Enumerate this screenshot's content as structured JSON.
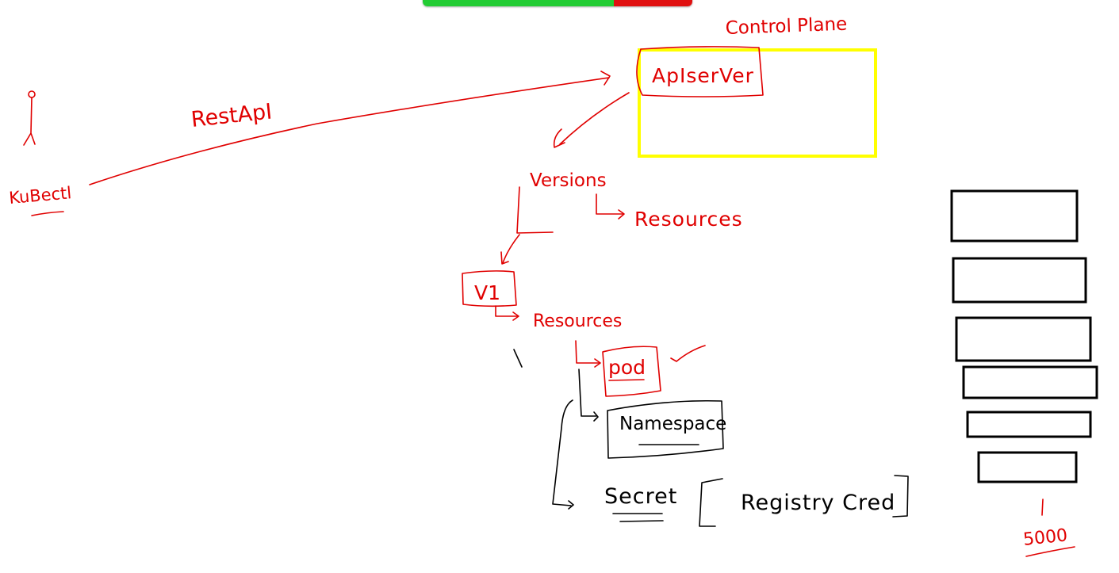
{
  "colors": {
    "ink_red": "#e00000",
    "ink_black": "#000000",
    "highlight_yellow": "#ffff00",
    "toolbar_green": "#22cc33",
    "toolbar_red": "#e01010"
  },
  "labels": {
    "control_plane": "Control Plane",
    "api_server": "ApIserVer",
    "rest_api": "RestApI",
    "kubectl": "KuBectl",
    "versions": "Versions",
    "resources_1": "Resources",
    "v1": "V1",
    "resources_2": "Resources",
    "pod": "pod",
    "namespace": "Namespace",
    "secret": "Secret",
    "registry_cred": "Registry Cred",
    "count": "5000"
  },
  "icons": {
    "person": "stick-figure-icon",
    "checkmark": "checkmark-icon"
  }
}
